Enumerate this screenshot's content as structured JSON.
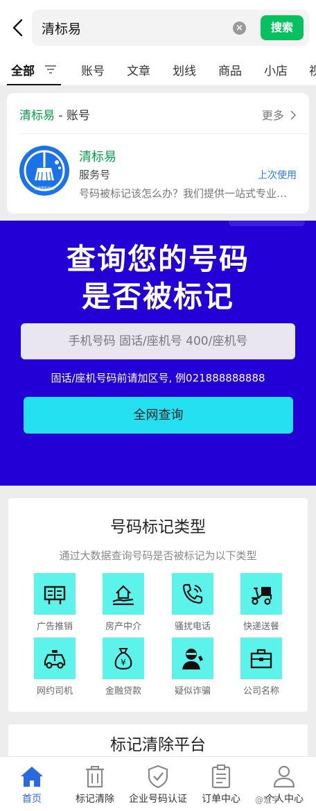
{
  "search": {
    "query": "清标易",
    "button": "搜索"
  },
  "tabs": [
    {
      "label": "全部",
      "active": true
    },
    {
      "label": "账号"
    },
    {
      "label": "文章"
    },
    {
      "label": "划线"
    },
    {
      "label": "商品"
    },
    {
      "label": "小店"
    },
    {
      "label": "视"
    }
  ],
  "account": {
    "section_name": "清标易",
    "section_suffix": " - 账号",
    "more": "更多",
    "name": "清标易",
    "type": "服务号",
    "last_used": "上次使用",
    "description": "号码被标记该怎么办？我们提供一站式专业服务",
    "avatar_text": "查询号码标记"
  },
  "hero": {
    "title_line1": "查询您的号码",
    "title_line2": "是否被标记",
    "input_placeholder": "手机号码 固话/座机号 400/座机号",
    "hint": "固话/座机号码前请加区号, 例021888888888",
    "button": "全网查询"
  },
  "mark_types": {
    "title": "号码标记类型",
    "subtitle": "通过大数据查询号码是否被标记为以下类型",
    "items": [
      {
        "label": "广告推销",
        "icon": "billboard-icon"
      },
      {
        "label": "房产中介",
        "icon": "house-hand-icon"
      },
      {
        "label": "骚扰电话",
        "icon": "phone-ring-icon"
      },
      {
        "label": "快递送餐",
        "icon": "scooter-icon"
      },
      {
        "label": "网约司机",
        "icon": "taxi-icon"
      },
      {
        "label": "金融贷款",
        "icon": "money-bag-icon"
      },
      {
        "label": "疑似诈骗",
        "icon": "thief-icon"
      },
      {
        "label": "公司名称",
        "icon": "briefcase-icon"
      }
    ]
  },
  "clear_platform": {
    "title": "标记清除平台"
  },
  "bottom_nav": [
    {
      "label": "首页",
      "icon": "home-icon",
      "active": true
    },
    {
      "label": "标记清除",
      "icon": "trash-icon"
    },
    {
      "label": "企业号码认证",
      "icon": "shield-check-icon"
    },
    {
      "label": "订单中心",
      "icon": "clipboard-icon"
    },
    {
      "label": "个人中心",
      "icon": "user-icon"
    }
  ],
  "watermark": "@宏宇",
  "colors": {
    "wechat_green": "#07c160",
    "hero_blue": "#2200d6",
    "cta_cyan": "#24e0f0",
    "tile_cyan": "#5cf3ea",
    "nav_active": "#2a6ae0"
  }
}
